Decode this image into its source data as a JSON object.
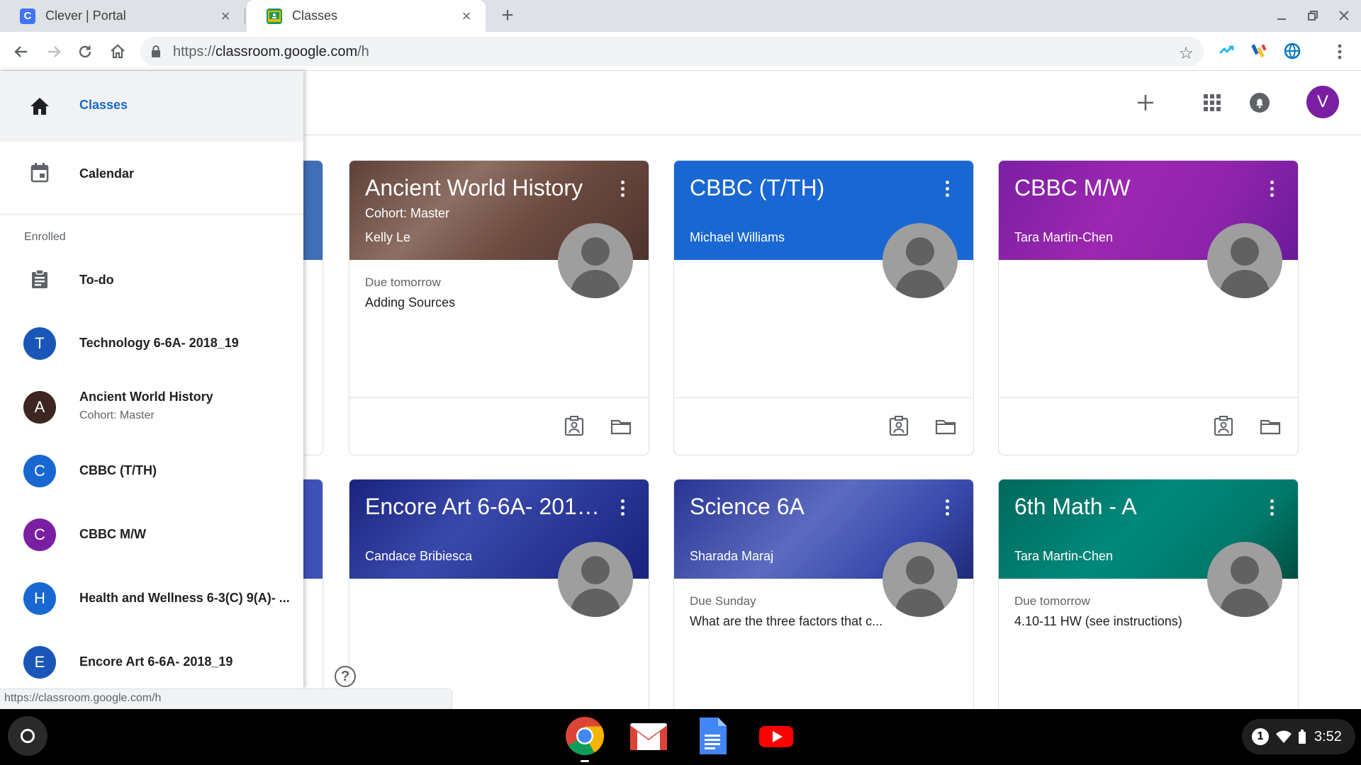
{
  "browser": {
    "tabs": [
      {
        "title": "Clever | Portal",
        "favicon_letter": "C",
        "favicon_color": "#4274f6"
      },
      {
        "title": "Classes",
        "favicon_color": "#0f9d58"
      }
    ],
    "url_prefix": "https://",
    "url_host": "classroom.google.com",
    "url_path": "/h"
  },
  "header": {
    "user_initial": "V",
    "user_color": "#7b1fa2"
  },
  "drawer": {
    "nav": [
      {
        "label": "Classes",
        "icon": "home-icon",
        "selected": true
      },
      {
        "label": "Calendar",
        "icon": "calendar-icon",
        "selected": false
      }
    ],
    "section_label": "Enrolled",
    "todo_label": "To-do",
    "classes": [
      {
        "initial": "T",
        "name": "Technology 6-6A- 2018_19",
        "sub": "",
        "color": "#1a56b8"
      },
      {
        "initial": "A",
        "name": "Ancient World History",
        "sub": "Cohort: Master",
        "color": "#3e2723"
      },
      {
        "initial": "C",
        "name": "CBBC (T/TH)",
        "sub": "",
        "color": "#1967d2"
      },
      {
        "initial": "C",
        "name": "CBBC M/W",
        "sub": "",
        "color": "#7b1fa2"
      },
      {
        "initial": "H",
        "name": "Health and Wellness 6-3(C) 9(A)- ...",
        "sub": "",
        "color": "#1967d2"
      },
      {
        "initial": "E",
        "name": "Encore Art 6-6A- 2018_19",
        "sub": "",
        "color": "#1a56b8"
      }
    ]
  },
  "cards": [
    {
      "title": "Ancient World History",
      "section": "Cohort: Master",
      "teacher": "Kelly Le",
      "due": "Due tomorrow",
      "work": "Adding Sources",
      "color": "#6d4c41"
    },
    {
      "title": "CBBC (T/TH)",
      "section": "",
      "teacher": "Michael Williams",
      "due": "",
      "work": "",
      "color": "#1967d2"
    },
    {
      "title": "CBBC M/W",
      "section": "",
      "teacher": "Tara Martin-Chen",
      "due": "",
      "work": "",
      "color": "#8e24aa"
    },
    {
      "title": "Encore Art 6-6A- 2018...",
      "section": "",
      "teacher": "Candace Bribiesca",
      "due": "",
      "work": "",
      "color": "#283593"
    },
    {
      "title": "Science 6A",
      "section": "",
      "teacher": "Sharada Maraj",
      "due": "Due Sunday",
      "work": "What are the three factors that c...",
      "color": "#3949ab"
    },
    {
      "title": "6th Math - A",
      "section": "",
      "teacher": "Tara Martin-Chen",
      "due": "Due tomorrow",
      "work": "4.10-11 HW (see instructions)",
      "color": "#00796b"
    }
  ],
  "status_url": "https://classroom.google.com/h",
  "help_label": "?",
  "tray": {
    "notifications": "1",
    "time": "3:52"
  }
}
